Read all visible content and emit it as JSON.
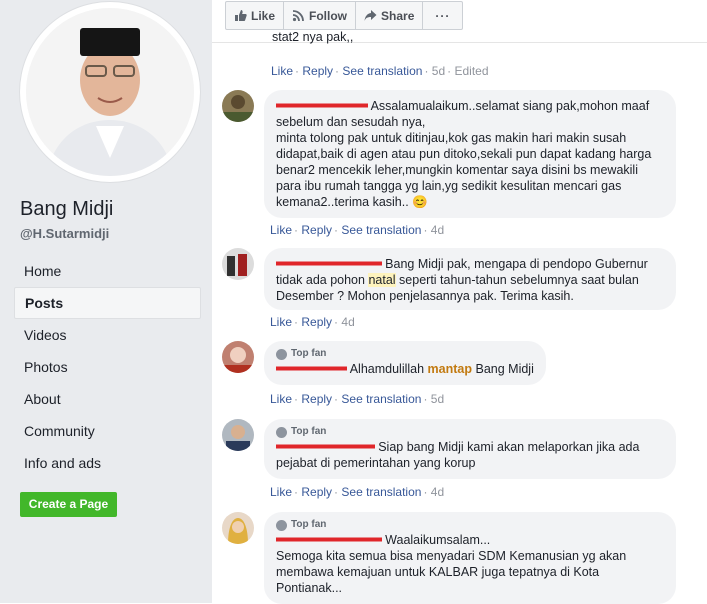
{
  "page": {
    "name": "Bang Midji",
    "handle": "@H.Sutarmidji"
  },
  "nav": {
    "items": [
      "Home",
      "Posts",
      "Videos",
      "Photos",
      "About",
      "Community",
      "Info and ads"
    ],
    "active": "Posts"
  },
  "create_page_label": "Create a Page",
  "toolbar": {
    "like": "Like",
    "follow": "Follow",
    "share": "Share",
    "more": "···"
  },
  "actions": {
    "like": "Like",
    "reply": "Reply",
    "see_translation": "See translation",
    "edited": "Edited"
  },
  "top_fan_label": "Top fan",
  "comments": [
    {
      "text": "stat2 nya pak,,",
      "time": "5d",
      "edited": true
    },
    {
      "text_prefix": "Assalamualaikum..selamat siang pak,mohon maaf sebelum dan sesudah nya,",
      "text_body": "minta tolong pak untuk ditinjau,kok gas makin hari makin susah didapat,baik di agen atau pun ditoko,sekali pun dapat kadang harga benar2 mencekik leher,mungkin komentar saya disini bs mewakili para ibu rumah tangga yg lain,yg sedikit kesulitan mencari gas kemana2..terima kasih..",
      "emoji": "😊",
      "time": "4d"
    },
    {
      "text_a": "Bang Midji pak, mengapa di pendopo Gubernur tidak ada pohon",
      "highlight": "natal",
      "text_b": "seperti tahun-tahun sebelumnya saat bulan Desember ? Mohon penjelasannya pak. Terima kasih.",
      "time": "4d"
    },
    {
      "top_fan": true,
      "text_a": "Alhamdulillah",
      "emph": "mantap",
      "text_b": "Bang Midji",
      "time": "5d"
    },
    {
      "top_fan": true,
      "text": "Siap bang Midji kami akan melaporkan jika ada pejabat di pemerintahan yang korup",
      "time": "4d"
    },
    {
      "top_fan": true,
      "text_a": "Waalaikumsalam...",
      "text_b": "Semoga kita semua bisa menyadari SDM Kemanusian yg akan membawa kemajuan untuk KALBAR juga tepatnya di Kota Pontianak..."
    }
  ],
  "colors": {
    "link": "#385898",
    "sidebar_bg": "#e9ebee",
    "bubble_bg": "#f2f3f5",
    "create_button": "#42b72a",
    "redaction": "#e0262a",
    "highlight": "#fef3bd"
  }
}
